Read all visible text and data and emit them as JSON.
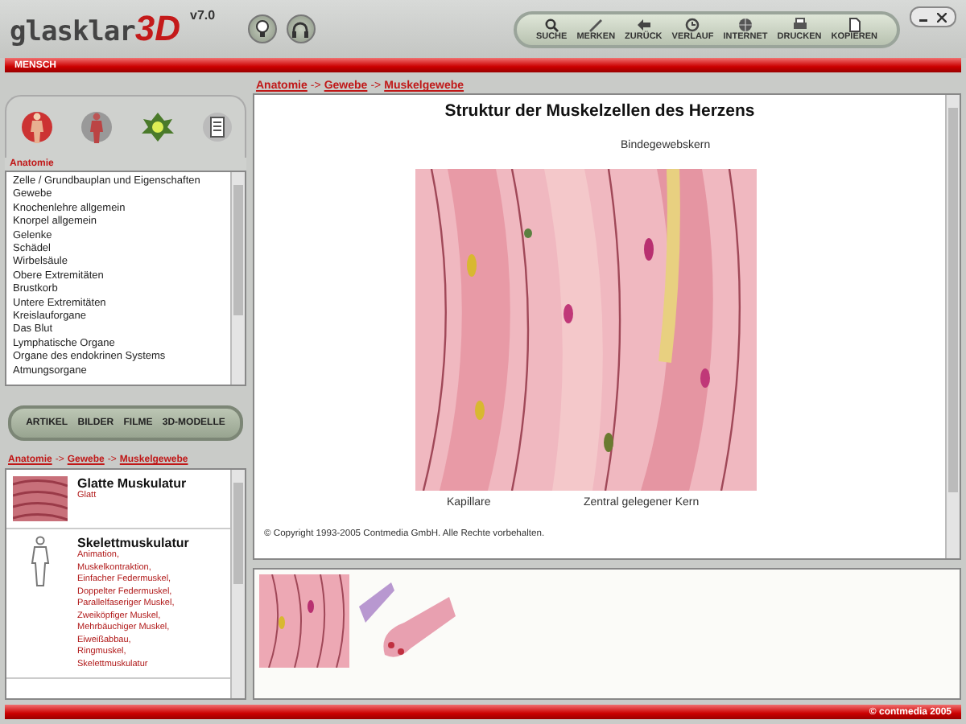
{
  "header": {
    "logo": "glasklar",
    "logo_accent": "3D",
    "version": "v7.0"
  },
  "toolbar": [
    {
      "label": "SUCHE"
    },
    {
      "label": "MERKEN"
    },
    {
      "label": "ZURÜCK"
    },
    {
      "label": "VERLAUF"
    },
    {
      "label": "INTERNET"
    },
    {
      "label": "DRUCKEN"
    },
    {
      "label": "KOPIEREN"
    }
  ],
  "menu_bar": {
    "title": "MENSCH"
  },
  "sidebar": {
    "section": "Anatomie",
    "items": [
      "Zelle / Grundbauplan und Eigenschaften",
      "Gewebe",
      "Knochenlehre allgemein",
      "Knorpel allgemein",
      "Gelenke",
      "Schädel",
      "Wirbelsäule",
      "Obere Extremitäten",
      "Brustkorb",
      "Untere Extremitäten",
      "Kreislauforgane",
      "Das Blut",
      "Lymphatische Organe",
      "Organe des endokrinen Systems",
      "Atmungsorgane"
    ],
    "tabs": [
      "ARTIKEL",
      "BILDER",
      "FILME",
      "3D-MODELLE"
    ],
    "breadcrumb": [
      "Anatomie",
      "Gewebe",
      "Muskelgewebe"
    ],
    "breadcrumb_separator": "->",
    "articles": [
      {
        "title": "Glatte Muskulatur",
        "kind": "tissue",
        "links": [
          "Glatt"
        ]
      },
      {
        "title": "Skelettmuskulatur",
        "kind": "figure",
        "links": [
          "Animation,",
          "Muskelkontraktion,",
          "Einfacher Federmuskel,",
          "Doppelter Federmuskel,",
          "Parallelfaseriger Muskel,",
          "Zweiköpfiger Muskel,",
          "Mehrbäuchiger Muskel,",
          "Eiweißabbau,",
          "Ringmuskel,",
          "Skelettmuskulatur"
        ]
      }
    ]
  },
  "content": {
    "breadcrumb": [
      "Anatomie",
      "Gewebe",
      "Muskelgewebe"
    ],
    "breadcrumb_separator": "->",
    "title": "Struktur der Muskelzellen des Herzens",
    "labels": [
      "Bindegewebskern",
      "Kapillare",
      "Zentral gelegener Kern"
    ],
    "copyright": "© Copyright 1993-2005 Contmedia GmbH. Alle Rechte vorbehalten."
  },
  "status_bar": {
    "text": "© contmedia 2005"
  }
}
